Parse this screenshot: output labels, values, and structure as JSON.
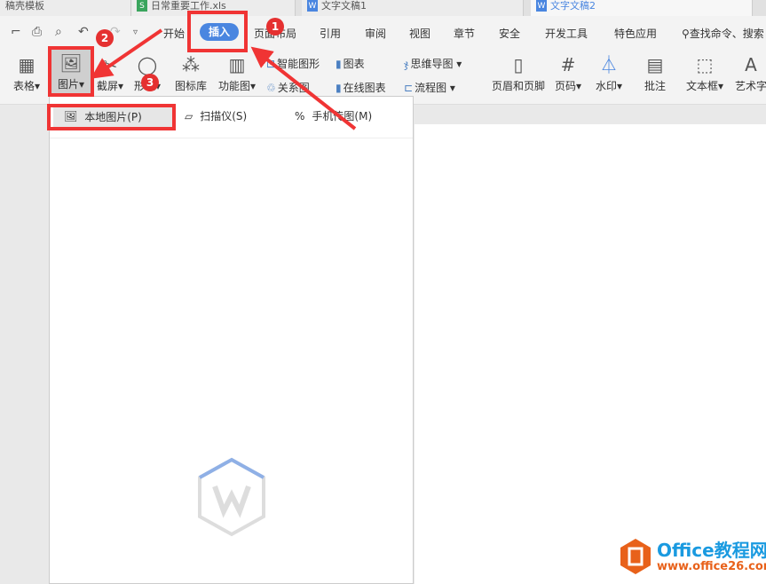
{
  "tabs": [
    {
      "label": "稿壳模板"
    },
    {
      "label": "日常重要工作.xls"
    },
    {
      "label": "文字文稿1"
    },
    {
      "label": "文字文稿2"
    }
  ],
  "menu": {
    "items": [
      "开始",
      "插入",
      "页面布局",
      "引用",
      "审阅",
      "视图",
      "章节",
      "安全",
      "开发工具",
      "特色应用"
    ],
    "active": "插入",
    "search": "查找命令、搜索"
  },
  "ribbon": {
    "big": [
      "表格",
      "图片",
      "截屏",
      "形状",
      "图标库",
      "功能图"
    ],
    "small": [
      "智能图形",
      "图表",
      "关系图",
      "在线图表",
      "思维导图",
      "流程图"
    ],
    "right": [
      "页眉和页脚",
      "页码",
      "水印",
      "批注",
      "文本框",
      "艺术字"
    ]
  },
  "dropdown": {
    "items": [
      "本地图片(P)",
      "扫描仪(S)",
      "手机传图(M)"
    ]
  },
  "annotations": [
    "1",
    "2",
    "3"
  ],
  "watermark": {
    "brand": "Office教程网",
    "url": "www.office26.com"
  },
  "colors": {
    "accent": "#4a86e0",
    "annotation": "#f03434",
    "brand": "#e8611a"
  }
}
